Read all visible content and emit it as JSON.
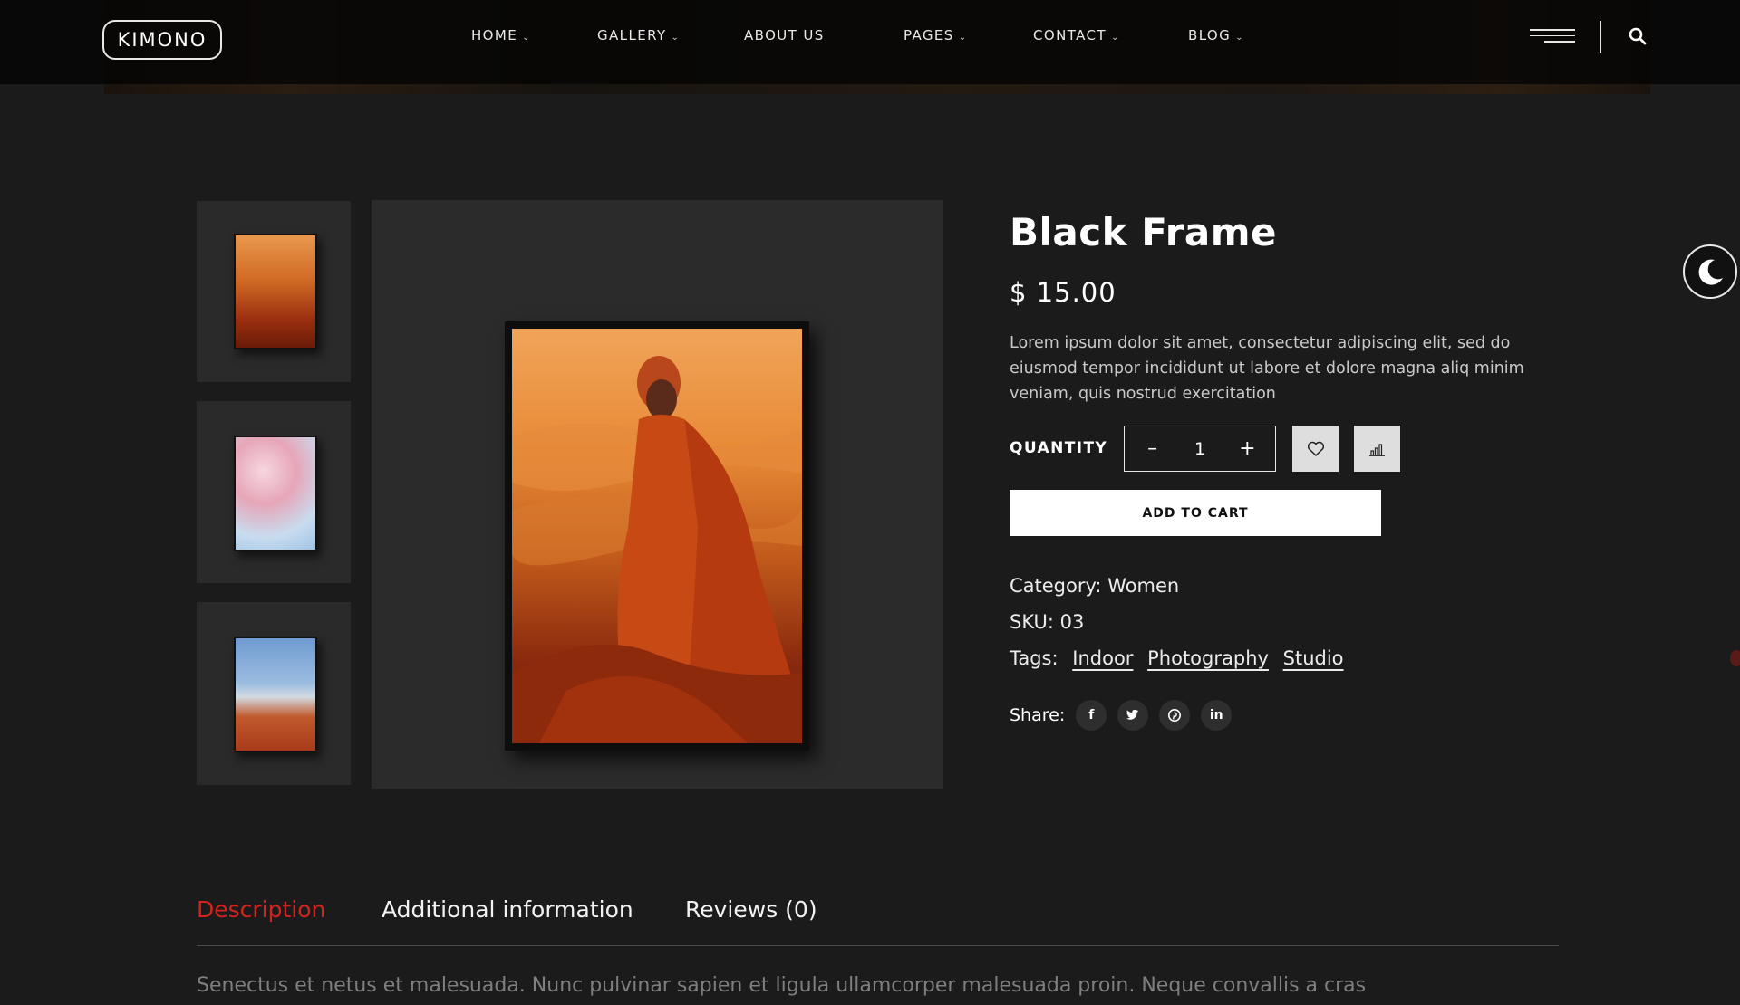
{
  "header": {
    "logo_text": "KIMONO",
    "nav": [
      {
        "label": "HOME",
        "has_dropdown": true
      },
      {
        "label": "GALLERY",
        "has_dropdown": true
      },
      {
        "label": "ABOUT US",
        "has_dropdown": false
      },
      {
        "label": "PAGES",
        "has_dropdown": true
      },
      {
        "label": "CONTACT",
        "has_dropdown": true
      },
      {
        "label": "BLOG",
        "has_dropdown": true
      }
    ],
    "icons": [
      "hamburger-menu-icon",
      "search-icon"
    ]
  },
  "gallery": {
    "thumbnails": [
      "woman-in-orange-desert",
      "cherry-blossom",
      "mountain-autumn"
    ],
    "main_image": "woman-in-orange-desert"
  },
  "product": {
    "title": "Black Frame",
    "price": "$ 15.00",
    "description": "Lorem ipsum dolor sit amet, consectetur adipiscing elit, sed do eiusmod tempor incididunt ut labore et dolore magna aliq minim veniam, quis nostrud exercitation",
    "quantity_label": "QUANTITY",
    "quantity_value": "1",
    "minus_label": "–",
    "plus_label": "+",
    "add_to_cart_label": "ADD TO CART",
    "category_label": "Category:",
    "category_value": "Women",
    "sku_label": "SKU:",
    "sku_value": "03",
    "tags_label": "Tags:",
    "tags": [
      "Indoor",
      "Photography",
      "Studio"
    ],
    "share_label": "Share:",
    "share_icons": [
      "facebook-icon",
      "twitter-icon",
      "pinterest-icon",
      "linkedin-icon"
    ]
  },
  "tabs": {
    "items": [
      "Description",
      "Additional information",
      "Reviews (0)"
    ],
    "active": "Description",
    "description_text": "Senectus et netus et malesuada. Nunc pulvinar sapien et ligula ullamcorper malesuada proin. Neque convallis a cras"
  },
  "colors": {
    "background": "#1b1b1b",
    "accent": "#d2231f",
    "panel": "#2b2b2b"
  }
}
